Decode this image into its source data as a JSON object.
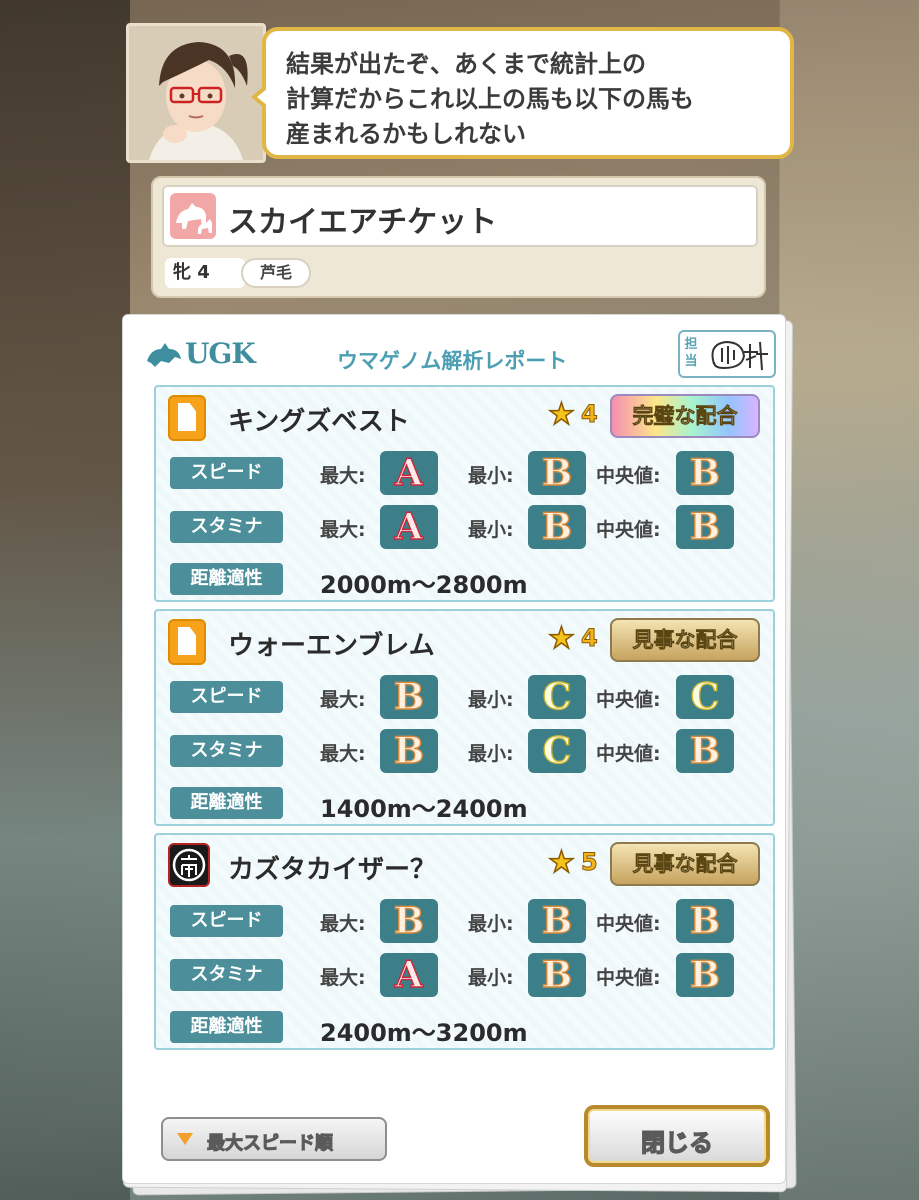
{
  "dialog": {
    "lines": [
      "結果が出たぞ、あくまで統計上の",
      "計算だからこれ以上の馬も以下の馬も",
      "産まれるかもしれない"
    ]
  },
  "horse": {
    "name": "スカイエアチケット",
    "sex_age": "牝 4",
    "coat": "芦毛"
  },
  "report": {
    "logo": "UGK",
    "title": "ウマゲノム解析レポート",
    "stamp_label": "担当",
    "labels": {
      "speed": "スピード",
      "stamina": "スタミナ",
      "distance": "距離適性",
      "max": "最大:",
      "min": "最小:",
      "median": "中央値:"
    },
    "sires": [
      {
        "name": "キングズベスト",
        "icon": "document-icon",
        "stars": "4",
        "match": "完璧な配合",
        "speed": {
          "max": "A",
          "min": "B",
          "median": "B"
        },
        "stamina": {
          "max": "A",
          "min": "B",
          "median": "B"
        },
        "distance": "2000m〜2800m"
      },
      {
        "name": "ウォーエンブレム",
        "icon": "document-icon",
        "stars": "4",
        "match": "見事な配合",
        "speed": {
          "max": "B",
          "min": "C",
          "median": "C"
        },
        "stamina": {
          "max": "B",
          "min": "C",
          "median": "B"
        },
        "distance": "1400m〜2400m"
      },
      {
        "name": "カズタカイザー？",
        "icon": "owner-crest-icon",
        "stars": "5",
        "match": "見事な配合",
        "speed": {
          "max": "B",
          "min": "B",
          "median": "B"
        },
        "stamina": {
          "max": "A",
          "min": "B",
          "median": "B"
        },
        "distance": "2400m〜3200m"
      }
    ]
  },
  "buttons": {
    "sort": "最大スピード順",
    "close": "閉じる"
  },
  "colors": {
    "accent": "#4c8f9a",
    "bubble_border": "#e0b646",
    "grade_A": "#c8273d",
    "grade_B": "#d88b3c",
    "grade_C": "#c9b632"
  }
}
